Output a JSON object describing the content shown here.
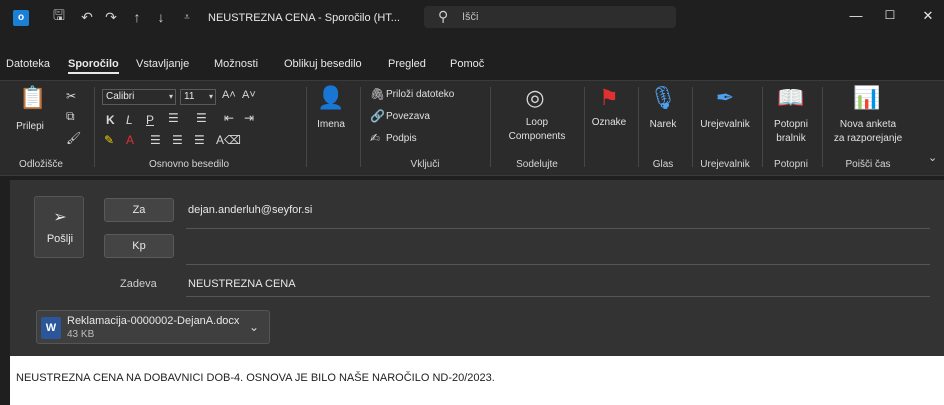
{
  "window": {
    "title": "NEUSTREZNA CENA  -  Sporočilo (HT...",
    "search_placeholder": "Išči",
    "app_icon": "outlook-icon",
    "minimize_icon": "minimize-icon",
    "maximize_icon": "maximize-icon",
    "close_icon": "close-icon"
  },
  "tabs": [
    "Datoteka",
    "Sporočilo",
    "Vstavljanje",
    "Možnosti",
    "Oblikuj besedilo",
    "Pregled",
    "Pomoč"
  ],
  "active_tab": "Sporočilo",
  "ribbon": {
    "paste_label": "Prilepi",
    "font_name": "Calibri",
    "font_size": "11",
    "bold": "K",
    "italic": "L",
    "underline": "P",
    "names_label": "Imena",
    "attach_file": "Priloži datoteko",
    "link": "Povezava",
    "signature": "Podpis",
    "loop_label_1": "Loop",
    "loop_label_2": "Components",
    "tags_label": "Oznake",
    "dictate_label": "Narek",
    "editor_label": "Urejevalnik",
    "reader_label_1": "Potopni",
    "reader_label_2": "bralnik",
    "poll_label_1": "Nova anketa",
    "poll_label_2": "za razporejanje",
    "groups": {
      "clipboard": "Odložišče",
      "basic_text": "Osnovno besedilo",
      "include": "Vključi",
      "collaborate": "Sodelujte",
      "voice": "Glas",
      "editor": "Urejevalnik",
      "immersive": "Potopni",
      "find_time": "Poišči čas"
    }
  },
  "compose": {
    "send_label": "Pošlji",
    "to_label": "Za",
    "to_value": "dejan.anderluh@seyfor.si",
    "cc_label": "Kp",
    "cc_value": "",
    "subject_label": "Zadeva",
    "subject_value": "NEUSTREZNA CENA"
  },
  "attachment": {
    "name": "Reklamacija-0000002-DejanA.docx",
    "size": "43 KB",
    "icon": "word-doc-icon"
  },
  "body_text": "NEUSTREZNA CENA NA DOBAVNICI DOB-4. OSNOVA JE BILO NAŠE NAROČILO ND-20/2023."
}
